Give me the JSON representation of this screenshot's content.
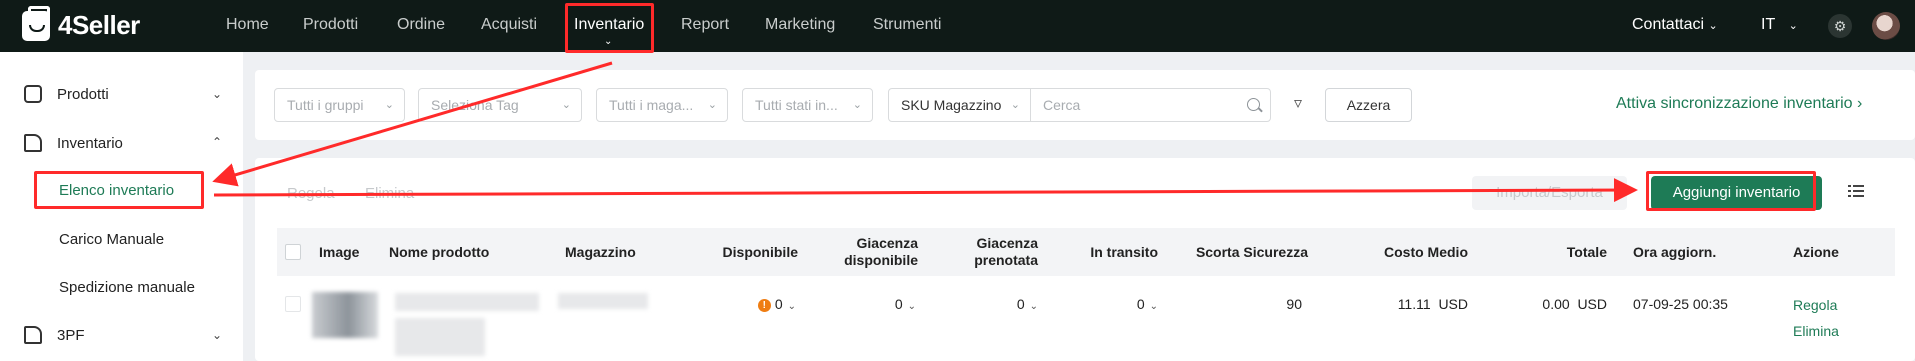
{
  "app": {
    "name": "4Seller"
  },
  "nav": {
    "items": [
      "Home",
      "Prodotti",
      "Ordine",
      "Acquisti",
      "Inventario",
      "Report",
      "Marketing",
      "Strumenti"
    ],
    "active": "Inventario",
    "contact": "Contattaci",
    "language": "IT"
  },
  "sidebar": {
    "prodotti": "Prodotti",
    "inventario": "Inventario",
    "sub": [
      "Elenco inventario",
      "Carico Manuale",
      "Spedizione manuale"
    ],
    "tpf": "3PF"
  },
  "filters": {
    "groups_placeholder": "Tutti i gruppi",
    "tag_placeholder": "Seleziona Tag",
    "warehouse_placeholder": "Tutti i maga...",
    "status_placeholder": "Tutti stati in...",
    "search_field": "SKU Magazzino",
    "search_placeholder": "Cerca",
    "reset_label": "Azzera",
    "sync_link": "Attiva sincronizzazione inventario"
  },
  "actions": {
    "adjust": "Regola",
    "delete": "Elimina",
    "import_export": "Importa/Esporta",
    "add_inventory": "Aggiungi inventario"
  },
  "table": {
    "headers": {
      "image": "Image",
      "product_name": "Nome prodotto",
      "warehouse": "Magazzino",
      "available": "Disponibile",
      "stock_available": "Giacenza disponibile",
      "stock_reserved": "Giacenza prenotata",
      "in_transit": "In transito",
      "safety_stock": "Scorta Sicurezza",
      "avg_cost": "Costo Medio",
      "total": "Totale",
      "updated_time": "Ora aggiorn.",
      "action": "Azione"
    },
    "rows": [
      {
        "available": "0",
        "stock_available": "0",
        "stock_reserved": "0",
        "in_transit": "0",
        "safety_stock": "90",
        "avg_cost": "11.11",
        "avg_cost_currency": "USD",
        "total": "0.00",
        "total_currency": "USD",
        "updated_time": "07-09-25 00:35",
        "actions": [
          "Regola",
          "Elimina"
        ]
      }
    ]
  },
  "colors": {
    "brand": "#1e7b56",
    "nav_bg": "#0f1a17",
    "annotation": "#ff2a2a"
  }
}
